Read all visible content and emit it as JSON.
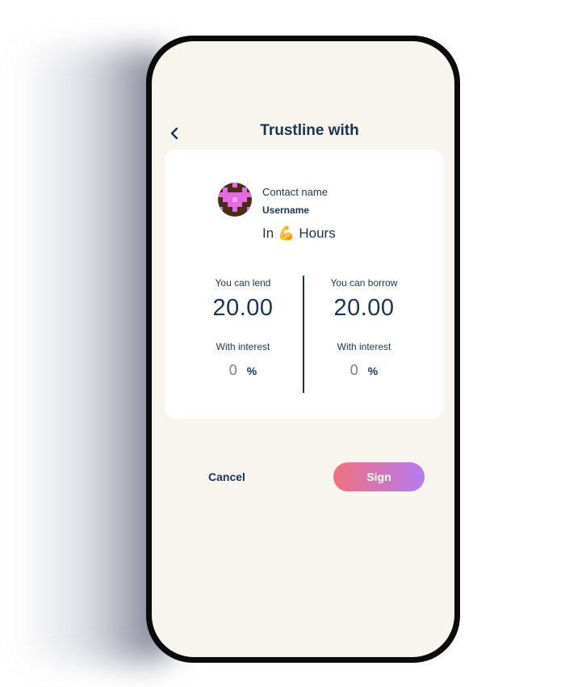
{
  "header": {
    "title": "Trustline with",
    "back_icon": "chevron-left-icon"
  },
  "contact": {
    "name": "Contact name",
    "username": "Username",
    "avatar_icon": "pixel-heart-avatar"
  },
  "currency": {
    "prefix": "In",
    "emoji": "💪",
    "name": "Hours"
  },
  "lend": {
    "label": "You can lend",
    "amount": "20.00",
    "interest_label": "With interest",
    "interest_value": "0",
    "interest_unit": "%"
  },
  "borrow": {
    "label": "You can borrow",
    "amount": "20.00",
    "interest_label": "With interest",
    "interest_value": "0",
    "interest_unit": "%"
  },
  "actions": {
    "cancel_label": "Cancel",
    "sign_label": "Sign"
  },
  "colors": {
    "primary_text": "#1a3553",
    "screen_bg": "#f8f5ef",
    "card_bg": "#ffffff",
    "sign_gradient_start": "#f0727e",
    "sign_gradient_end": "#b57af0"
  }
}
